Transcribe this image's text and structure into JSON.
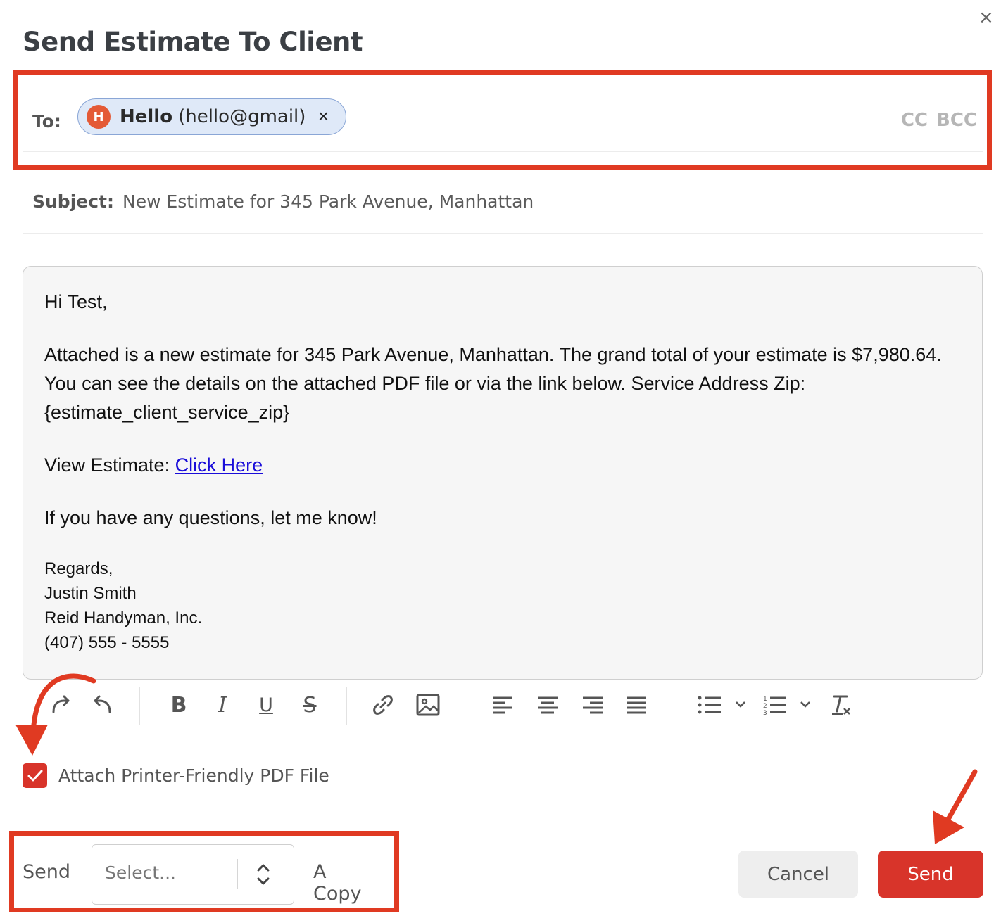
{
  "dialog": {
    "title": "Send Estimate To Client",
    "close_symbol": "×"
  },
  "to": {
    "label": "To:",
    "recipient": {
      "initial": "H",
      "name": "Hello",
      "email": "(hello@gmail)",
      "remove_symbol": "×"
    },
    "cc_label": "CC",
    "bcc_label": "BCC"
  },
  "subject": {
    "label": "Subject:",
    "value": "New Estimate for 345 Park Avenue, Manhattan"
  },
  "body": {
    "greeting": "Hi Test,",
    "para1": "Attached is a new estimate for 345 Park Avenue, Manhattan. The grand total of your estimate is $7,980.64. You can see the details on the attached PDF file or via the link below. Service Address Zip: {estimate_client_service_zip}",
    "view_label": "View Estimate: ",
    "view_link": "Click Here",
    "questions": "If you have any questions, let me know!",
    "signature": [
      "Regards,",
      "Justin Smith",
      "Reid Handyman, Inc.",
      "(407) 555 - 5555"
    ]
  },
  "toolbar": {
    "icons": [
      "redo-icon",
      "undo-icon",
      "bold-icon",
      "italic-icon",
      "underline-icon",
      "strikethrough-icon",
      "link-icon",
      "image-icon",
      "align-left-icon",
      "align-center-icon",
      "align-right-icon",
      "align-justify-icon",
      "bulleted-list-icon",
      "numbered-list-icon",
      "clear-format-icon"
    ],
    "bold_glyph": "B",
    "italic_glyph": "I",
    "underline_glyph": "U",
    "strike_glyph": "S"
  },
  "attach": {
    "checked": true,
    "label": "Attach Printer-Friendly PDF File"
  },
  "send_copy": {
    "prefix": "Send",
    "placeholder": "Select...",
    "suffix": "A Copy"
  },
  "buttons": {
    "cancel": "Cancel",
    "send": "Send"
  },
  "colors": {
    "accent": "#d8342a",
    "annotation": "#e03a22",
    "chip_bg": "#dfe9f8",
    "link": "#1a0dd9"
  }
}
